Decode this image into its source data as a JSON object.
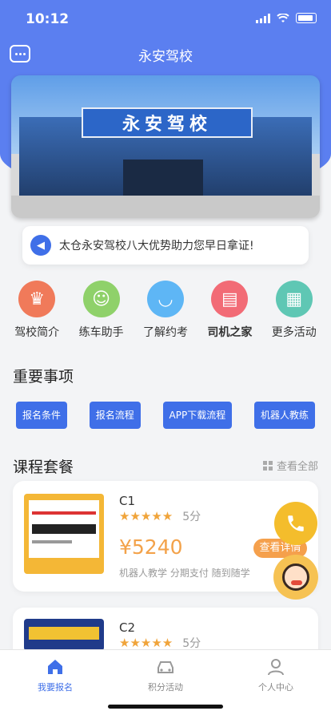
{
  "status": {
    "time": "10:12"
  },
  "navbar": {
    "title": "永安驾校"
  },
  "banner": {
    "sign_text": "永安驾校"
  },
  "notice": {
    "text": "太仓永安驾校八大优势助力您早日拿证!"
  },
  "quick_links": [
    {
      "label": "驾校简介",
      "icon": "crown-icon",
      "color": "#f07a5a",
      "bold": false
    },
    {
      "label": "练车助手",
      "icon": "person-icon",
      "color": "#8fd16a",
      "bold": false
    },
    {
      "label": "了解约考",
      "icon": "smile-icon",
      "color": "#5eb6f5",
      "bold": false
    },
    {
      "label": "司机之家",
      "icon": "book-icon",
      "color": "#f26b76",
      "bold": true
    },
    {
      "label": "更多活动",
      "icon": "grid-apps-icon",
      "color": "#5fc7b4",
      "bold": false
    }
  ],
  "important": {
    "title": "重要事项",
    "tags": [
      "报名条件",
      "报名流程",
      "APP下载流程",
      "机器人教练"
    ]
  },
  "courses": {
    "title": "课程套餐",
    "view_all": "查看全部",
    "items": [
      {
        "name": "C1",
        "score": "5分",
        "price": "¥5240",
        "features": "机器人教学  分期支付  随到随学",
        "detail": "查看详情"
      },
      {
        "name": "C2",
        "score": "5分"
      }
    ]
  },
  "tabbar": {
    "items": [
      {
        "label": "我要报名",
        "icon": "home-icon",
        "active": true
      },
      {
        "label": "积分活动",
        "icon": "car-icon",
        "active": false
      },
      {
        "label": "个人中心",
        "icon": "user-icon",
        "active": false
      }
    ]
  },
  "colors": {
    "primary": "#5b7ff0",
    "accent": "#3f6fe8",
    "price": "#f3a24a",
    "star": "#f0a43a"
  }
}
